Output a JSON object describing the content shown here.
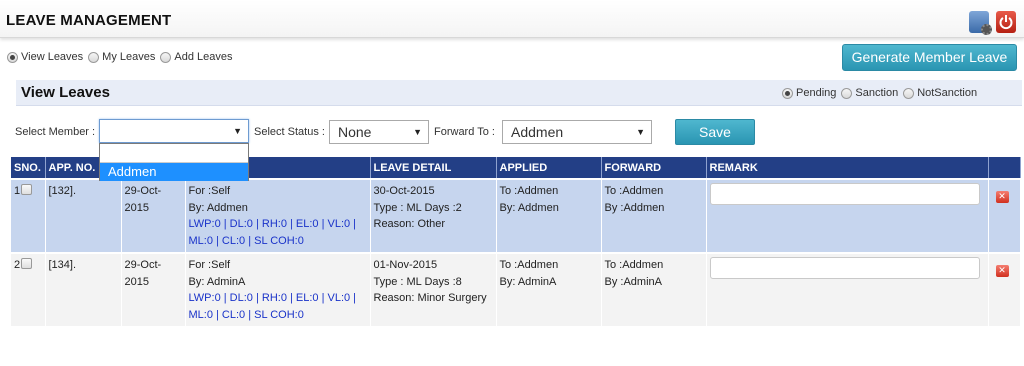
{
  "app": {
    "title": "LEAVE MANAGEMENT"
  },
  "top_icons": [
    "settings-icon",
    "power-icon"
  ],
  "view_options": [
    {
      "label": "View Leaves",
      "checked": true
    },
    {
      "label": "My Leaves",
      "checked": false
    },
    {
      "label": "Add Leaves",
      "checked": false
    }
  ],
  "generate_button": "Generate Member Leave",
  "panel": {
    "title": "View Leaves"
  },
  "status_options": [
    {
      "label": "Pending",
      "checked": true
    },
    {
      "label": "Sanction",
      "checked": false
    },
    {
      "label": "NotSanction",
      "checked": false
    }
  ],
  "filters": {
    "member_label": "Select Member :",
    "member_value": "",
    "member_options": [
      "",
      "Addmen"
    ],
    "status_label": "Select Status :",
    "status_value": "None",
    "forward_label": "Forward To :",
    "forward_value": "Addmen"
  },
  "save_button": "Save",
  "table": {
    "headers": [
      "SNO.",
      "APP. NO.",
      "",
      "",
      "LEAVE DETAIL",
      "APPLIED",
      "FORWARD",
      "REMARK",
      ""
    ],
    "rows": [
      {
        "sno": "1",
        "app_no": "[132].",
        "date": "29-Oct-2015",
        "for": "For :Self",
        "by": "By: Addmen",
        "leave_balance": "LWP:0 | DL:0 | RH:0 | EL:0 | VL:0 | ML:0 | CL:0 | SL COH:0",
        "detail_date": "30-Oct-2015",
        "detail_type": "Type : ML Days :2",
        "detail_reason": "Reason: Other",
        "applied_to": "To :Addmen",
        "applied_by": "By: Addmen",
        "forward_to": "To :Addmen",
        "forward_by": "By :Addmen",
        "remark": ""
      },
      {
        "sno": "2",
        "app_no": "[134].",
        "date": "29-Oct-2015",
        "for": "For :Self",
        "by": "By: AdminA",
        "leave_balance": "LWP:0 | DL:0 | RH:0 | EL:0 | VL:0 | ML:0 | CL:0 | SL COH:0",
        "detail_date": "01-Nov-2015",
        "detail_type": "Type : ML Days :8",
        "detail_reason": "Reason: Minor Surgery",
        "applied_to": "To :Addmen",
        "applied_by": "By: AdminA",
        "forward_to": "To :Addmen",
        "forward_by": "By :AdminA",
        "remark": ""
      }
    ]
  },
  "colors": {
    "header_bg": "#233f86",
    "row1_bg": "#c6d5ee",
    "row2_bg": "#f3f3f3",
    "button_bg": "#3aa6c2",
    "link_blue": "#1a33c9",
    "dropdown_highlight": "#1e90ff"
  }
}
